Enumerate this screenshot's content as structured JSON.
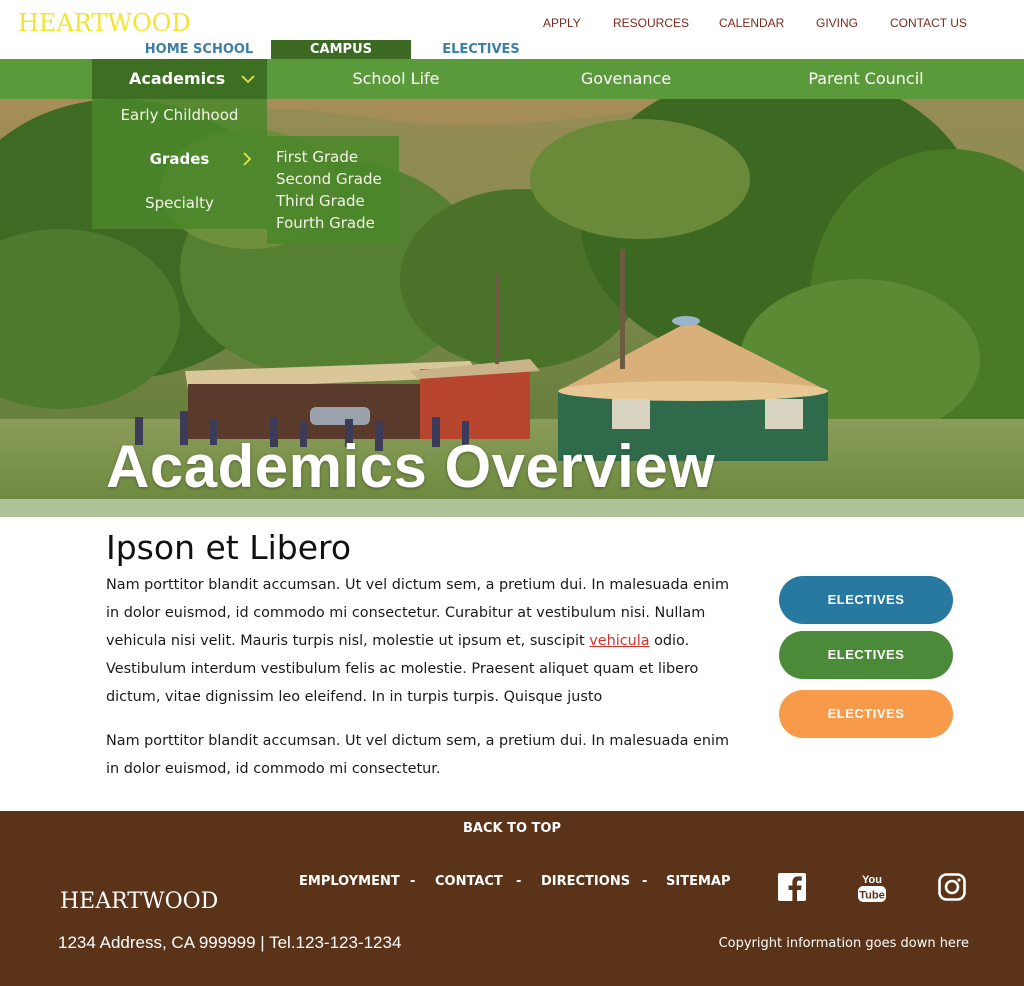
{
  "brand": {
    "logo_text": "HEARTWOOD",
    "logo_color": "#f0e531",
    "footer_logo_text": "HEARTWOOD"
  },
  "utility_nav": [
    "APPLY",
    "RESOURCES",
    "CALENDAR",
    "GIVING",
    "CONTACT US"
  ],
  "section_tabs": [
    {
      "label": "HOME SCHOOL",
      "active": false
    },
    {
      "label": "CAMPUS",
      "active": true
    },
    {
      "label": "ELECTIVES",
      "active": false
    }
  ],
  "main_nav": [
    {
      "label": "Academics",
      "active": true
    },
    {
      "label": "School Life",
      "active": false
    },
    {
      "label": "Govenance",
      "active": false
    },
    {
      "label": "Parent Council",
      "active": false
    }
  ],
  "dropdown": {
    "items": [
      "Early Childhood",
      "Grades",
      "Specialty"
    ],
    "selected": "Grades",
    "submenu": [
      "First Grade",
      "Second Grade",
      "Third Grade",
      "Fourth Grade"
    ]
  },
  "hero": {
    "title": "Academics Overview"
  },
  "content": {
    "heading": "Ipson et Libero",
    "para1_before_link": "Nam porttitor blandit accumsan. Ut vel dictum sem, a pretium dui. In malesuada enim in dolor euismod, id commodo mi consectetur. Curabitur at vestibulum nisi. Nullam vehicula nisi velit. Mauris turpis nisl, molestie ut ipsum et, suscipit ",
    "para1_link": "vehicula",
    "para1_after_link": " odio. Vestibulum interdum vestibulum felis ac molestie. Praesent aliquet quam et libero dictum, vitae dignissim leo eleifend. In in turpis turpis. Quisque justo",
    "para2": "Nam porttitor blandit accumsan. Ut vel dictum sem, a pretium dui. In malesuada enim in dolor euismod, id commodo mi consectetur."
  },
  "side_buttons": [
    {
      "label": "ELECTIVES",
      "color": "#2879a0"
    },
    {
      "label": "ELECTIVES",
      "color": "#4a8a38"
    },
    {
      "label": "ELECTIVES",
      "color": "#f79a4a"
    }
  ],
  "footer": {
    "back_to_top": "BACK TO TOP",
    "links": [
      "EMPLOYMENT",
      "CONTACT",
      "DIRECTIONS",
      "SITEMAP"
    ],
    "separator": "-",
    "address": "1234 Address, CA 999999 |  Tel.123-123-1234",
    "copyright": "Copyright information goes down here",
    "social_icons": [
      "facebook-icon",
      "youtube-icon",
      "instagram-icon"
    ],
    "background": "#5a3318"
  },
  "colors": {
    "nav_green": "#5b9a3a",
    "nav_active": "#3d6f22",
    "link_red": "#d0332b"
  }
}
